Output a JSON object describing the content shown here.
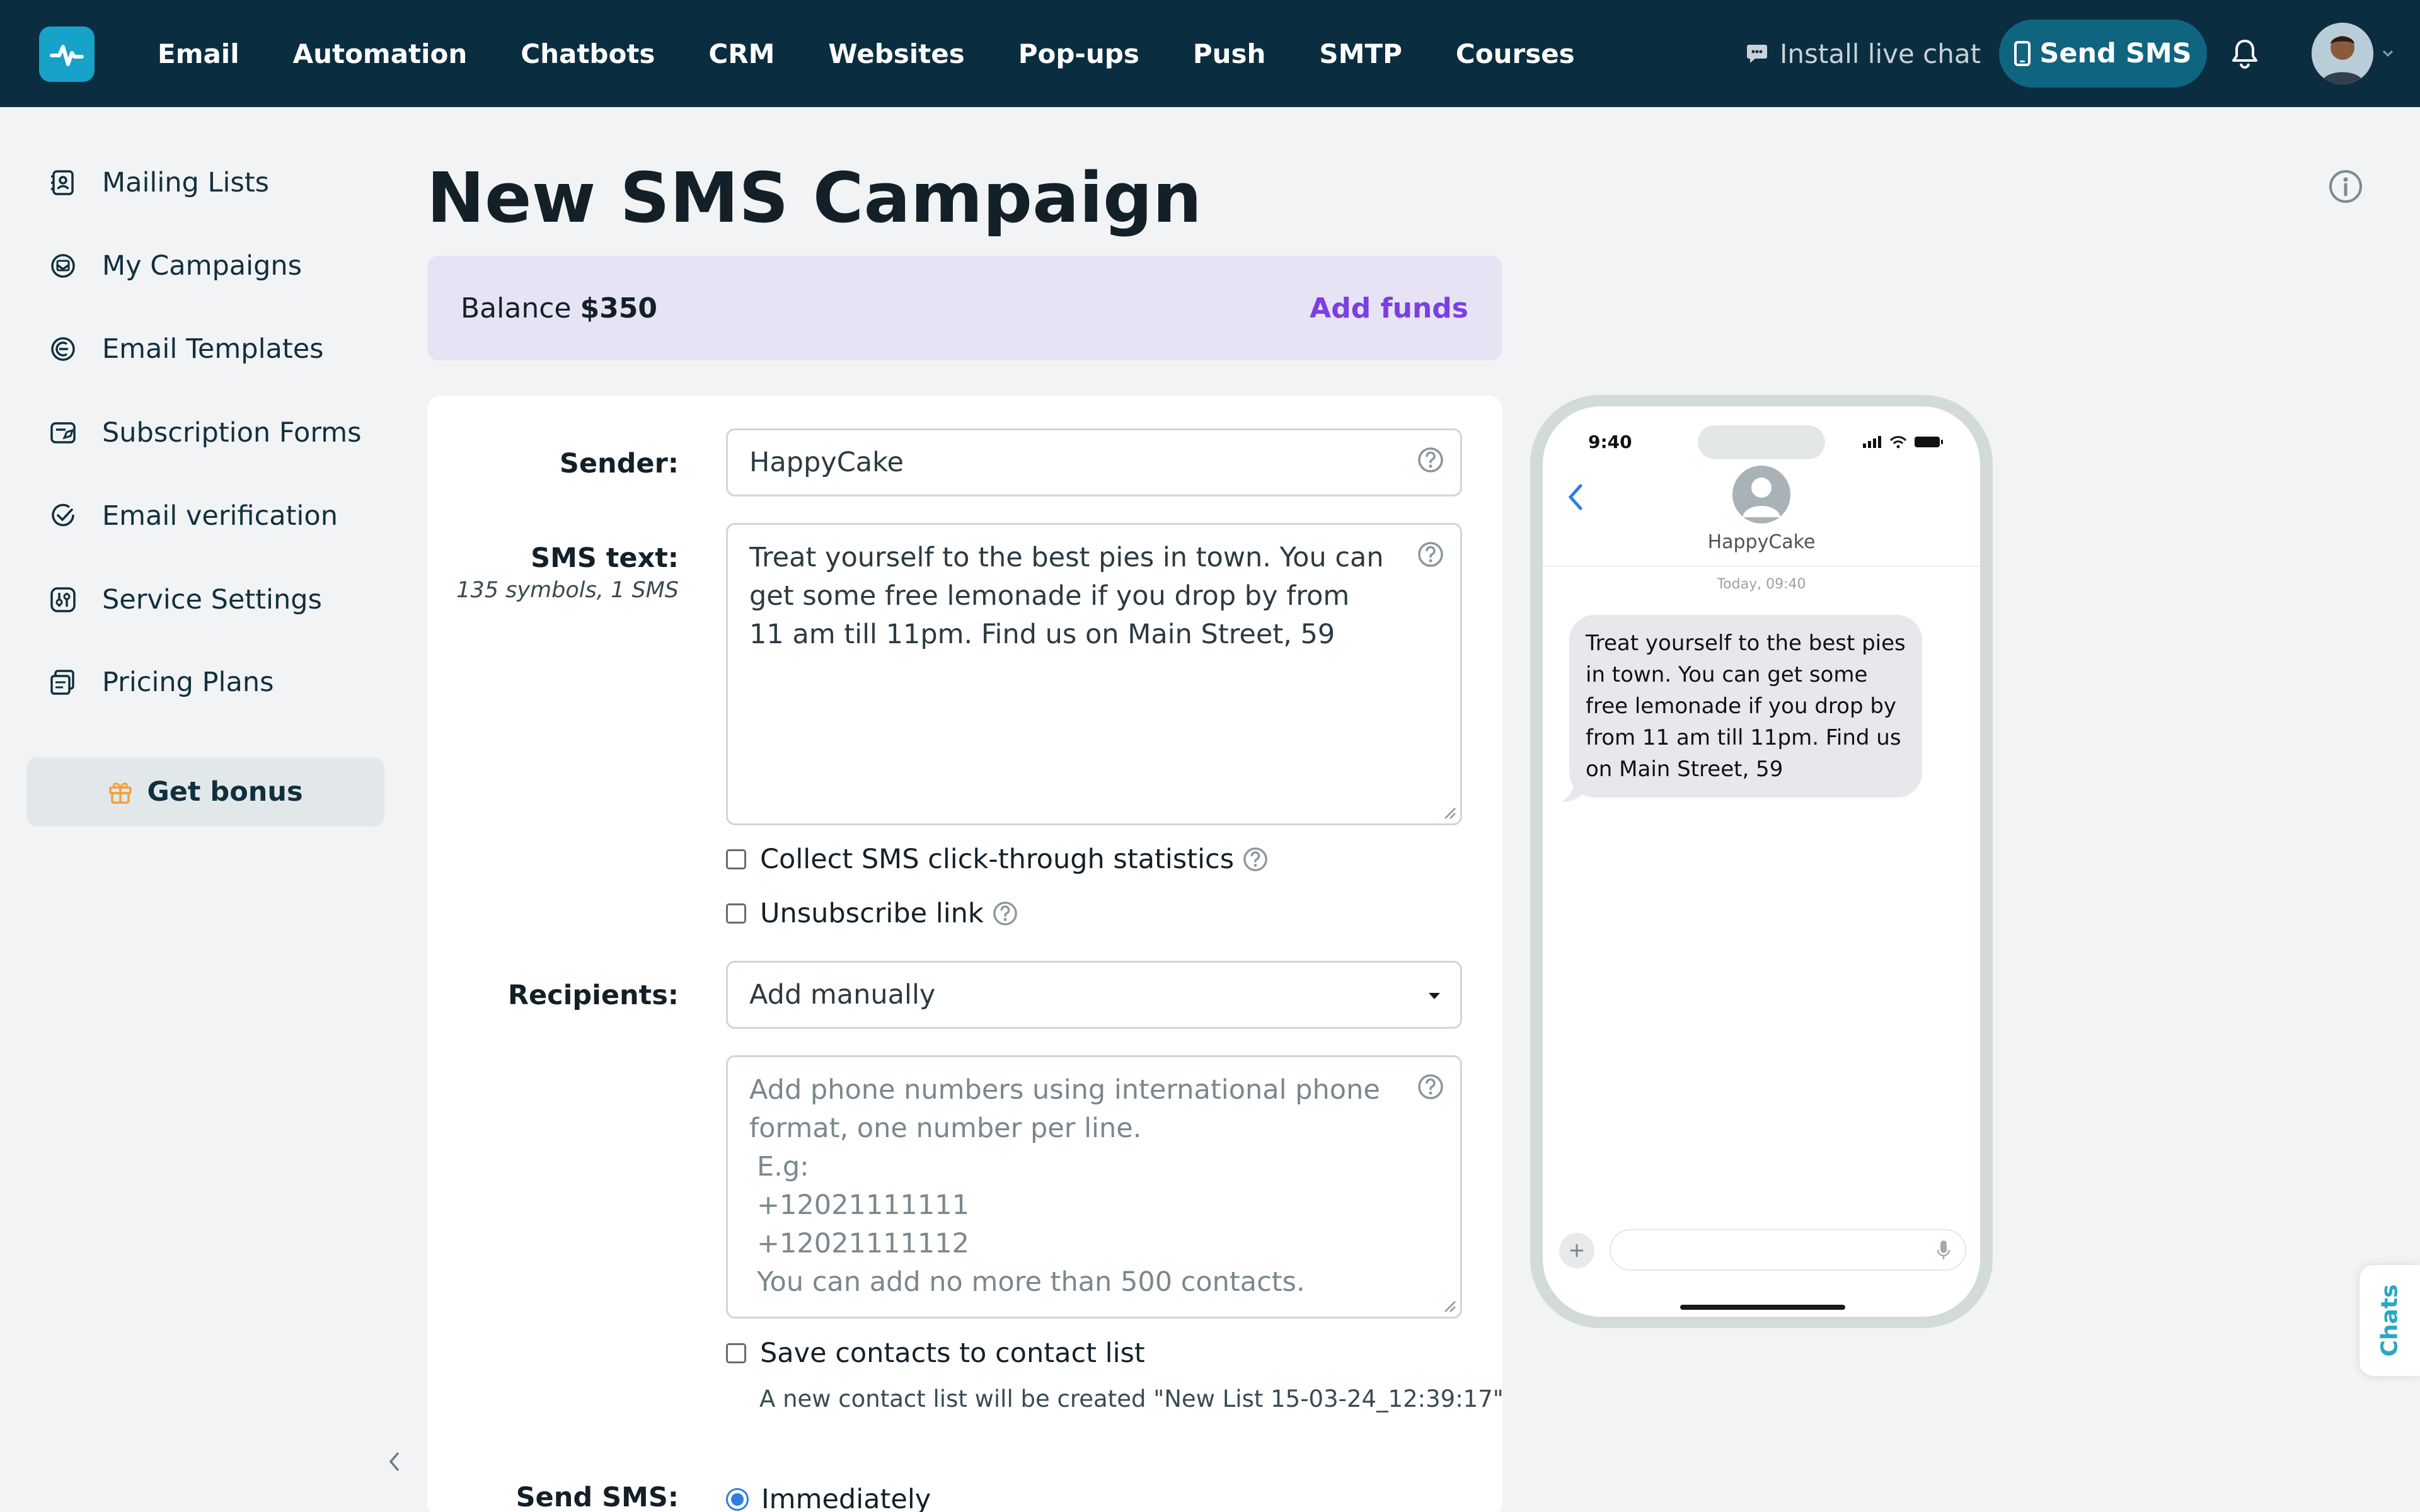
{
  "topnav": {
    "items": [
      "Email",
      "Automation",
      "Chatbots",
      "CRM",
      "Websites",
      "Pop-ups",
      "Push",
      "SMTP",
      "Courses"
    ],
    "install_live_chat": "Install live chat",
    "send_sms": "Send SMS"
  },
  "sidebar": {
    "items": [
      {
        "label": "Mailing Lists",
        "icon": "mailing-lists-icon"
      },
      {
        "label": "My Campaigns",
        "icon": "campaigns-icon"
      },
      {
        "label": "Email Templates",
        "icon": "templates-icon"
      },
      {
        "label": "Subscription Forms",
        "icon": "forms-icon"
      },
      {
        "label": "Email verification",
        "icon": "verification-icon"
      },
      {
        "label": "Service Settings",
        "icon": "settings-icon"
      },
      {
        "label": "Pricing Plans",
        "icon": "pricing-icon"
      }
    ],
    "bonus": "Get bonus"
  },
  "page": {
    "title": "New SMS Campaign"
  },
  "balance": {
    "label": "Balance",
    "amount": "$350",
    "add_funds": "Add funds"
  },
  "form": {
    "sender_label": "Sender:",
    "sender_value": "HappyCake",
    "sms_text_label": "SMS text:",
    "sms_text_meta": "135 symbols, 1 SMS",
    "sms_text_value": "Treat yourself to the best pies in town. You can get some free lemonade if you drop by from 11 am till 11pm. Find us on Main Street, 59",
    "collect_stats_label": "Collect SMS click-through statistics",
    "unsubscribe_label": "Unsubscribe link",
    "recipients_label": "Recipients:",
    "recipients_value": "Add manually",
    "phones_placeholder": {
      "line1": "Add phone numbers using international phone format, one number per line.",
      "line2": "E.g:",
      "line3": "+12021111111",
      "line4": "+12021111112",
      "line5": "You can add no more than 500 contacts."
    },
    "save_contacts_label": "Save contacts to contact list",
    "new_list_note": "A new contact list will be created \"New List 15-03-24_12:39:17\"",
    "send_sms_label": "Send SMS:",
    "send_option": "Immediately"
  },
  "preview": {
    "time": "9:40",
    "contact": "HappyCake",
    "date": "Today, 09:40",
    "message": "Treat yourself to the best pies in town. You can get some free lemonade if you drop by from 11 am till 11pm. Find us on Main Street, 59"
  },
  "chats_tab": "Chats",
  "colors": {
    "topbar": "#0b2d40",
    "accent": "#16a2c9",
    "send_sms_button": "#0f6580",
    "add_funds": "#7b3fe4",
    "balance_bg": "#e6e4f4",
    "radio": "#2f7de2"
  }
}
